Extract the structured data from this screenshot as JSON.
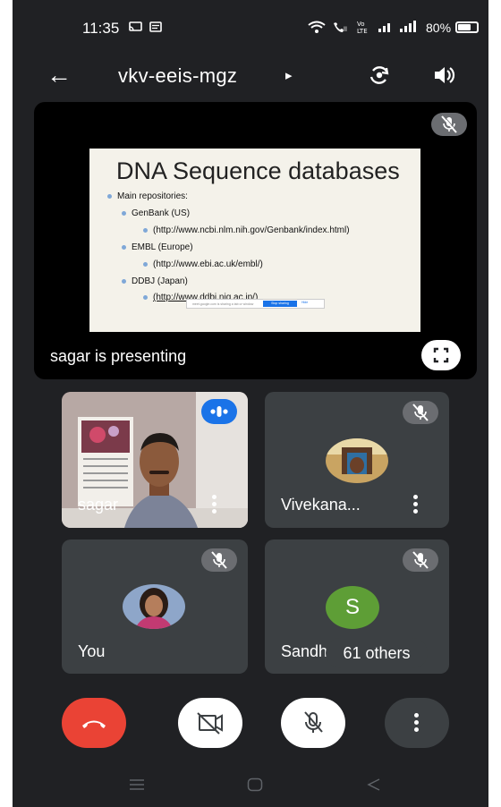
{
  "status_bar": {
    "time": "11:35",
    "battery_percent": "80%",
    "battery_level": 0.8,
    "icons": [
      "cast-icon",
      "message-icon",
      "wifi-icon",
      "wifi-calling-icon",
      "volte-icon",
      "signal-icon",
      "signal-icon",
      "battery-icon"
    ]
  },
  "header": {
    "meeting_code": "vkv-eeis-mgz",
    "caret": "▸"
  },
  "presentation": {
    "slide": {
      "title": "DNA Sequence databases",
      "bullets": [
        "Main repositories:",
        "GenBank (US)",
        "(http://www.ncbi.nlm.nih.gov/Genbank/index.html)",
        "EMBL (Europe)",
        "(http://www.ebi.ac.uk/embl/)",
        "DDBJ (Japan)",
        "(http://www.ddbj.nig.ac.jp/)"
      ],
      "share_bar_text": "meet.google.com is sharing a tab or window",
      "share_bar_stop": "Stop sharing",
      "share_bar_hide": "Hide"
    },
    "presenting_label": "sagar is presenting"
  },
  "tiles": [
    {
      "name": "sagar",
      "type": "video"
    },
    {
      "name": "Vivekana...",
      "type": "photo",
      "muted": true
    },
    {
      "name": "You",
      "type": "photo",
      "muted": true
    },
    {
      "name": "Sandh",
      "type": "letter",
      "letter": "S",
      "muted": true,
      "others_label": "61 others"
    }
  ],
  "colors": {
    "background": "#202124",
    "tile": "#3c4043",
    "end_call": "#ea4335",
    "avatar_s": "#5e9e36",
    "speaking": "#1a73e8"
  },
  "controls": [
    "end-call-button",
    "camera-off-button",
    "mic-off-button",
    "more-options-button"
  ]
}
